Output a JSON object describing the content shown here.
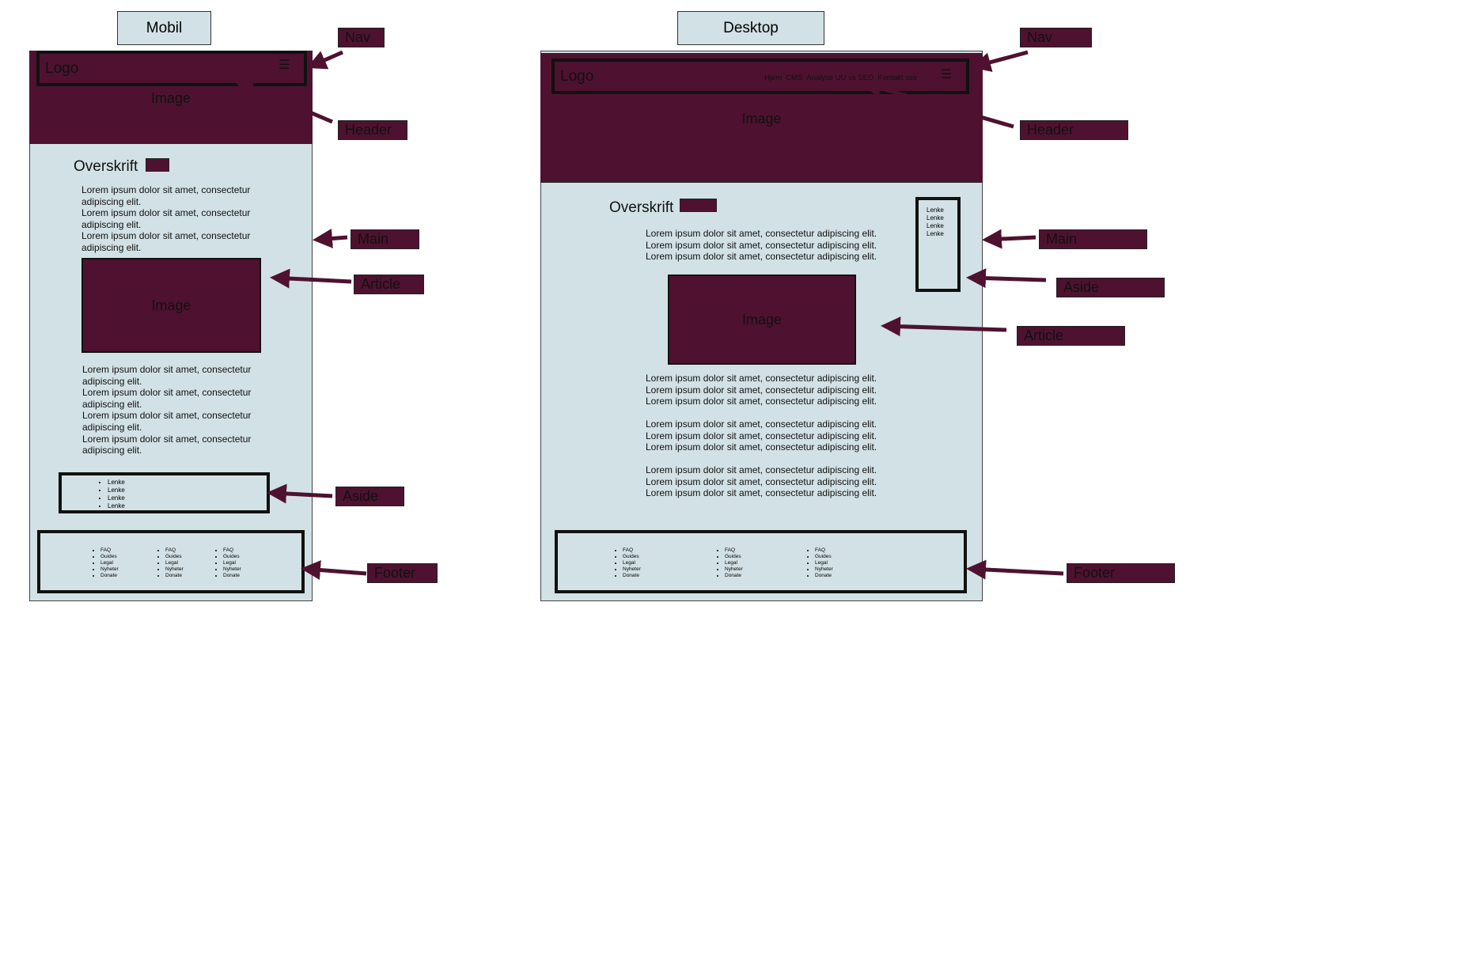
{
  "mobile": {
    "title": "Mobil",
    "logo": "Logo",
    "header_image": "Image",
    "heading": "Overskrift",
    "intro_lines": [
      "Lorem ipsum dolor sit amet, consectetur",
      "adipiscing elit.",
      "Lorem ipsum dolor sit amet, consectetur",
      "adipiscing elit.",
      "Lorem ipsum dolor sit amet, consectetur",
      "adipiscing elit."
    ],
    "article_image": "Image",
    "body_lines": [
      "Lorem ipsum dolor sit amet, consectetur",
      "adipiscing elit.",
      "Lorem ipsum dolor sit amet, consectetur",
      "adipiscing elit.",
      "Lorem ipsum dolor sit amet, consectetur",
      "adipiscing elit.",
      "Lorem ipsum dolor sit amet, consectetur",
      "adipiscing elit."
    ],
    "aside_links": [
      "Lenke",
      "Lenke",
      "Lenke",
      "Lenke"
    ],
    "footer_columns": [
      [
        "FAQ",
        "Guides",
        "Legal",
        "Nyheter",
        "Donate"
      ],
      [
        "FAQ",
        "Guides",
        "Legal",
        "Nyheter",
        "Donate"
      ],
      [
        "FAQ",
        "Guides",
        "Legal",
        "Nyheter",
        "Donate"
      ]
    ],
    "labels": {
      "nav": "Nav",
      "header": "Header",
      "main": "Main",
      "article": "Article",
      "aside": "Aside",
      "footer": "Footer"
    }
  },
  "desktop": {
    "title": "Desktop",
    "logo": "Logo",
    "nav_links": [
      "Hjem",
      "CMS",
      "Analyse UU vs SEO",
      "Kontakt oss"
    ],
    "header_image": "Image",
    "heading": "Overskrift",
    "intro_lines": [
      "Lorem ipsum dolor sit amet, consectetur adipiscing elit.",
      "Lorem ipsum dolor sit amet, consectetur adipiscing elit.",
      "Lorem ipsum dolor sit amet, consectetur adipiscing elit."
    ],
    "article_image": "Image",
    "paragraphs": [
      [
        "Lorem ipsum dolor sit amet, consectetur adipiscing elit.",
        "Lorem ipsum dolor sit amet, consectetur adipiscing elit.",
        "Lorem ipsum dolor sit amet, consectetur adipiscing elit."
      ],
      [
        "Lorem ipsum dolor sit amet, consectetur adipiscing elit.",
        "Lorem ipsum dolor sit amet, consectetur adipiscing elit.",
        "Lorem ipsum dolor sit amet, consectetur adipiscing elit."
      ],
      [
        "Lorem ipsum dolor sit amet, consectetur adipiscing elit.",
        "Lorem ipsum dolor sit amet, consectetur adipiscing elit.",
        "Lorem ipsum dolor sit amet, consectetur adipiscing elit."
      ]
    ],
    "aside_links": [
      "Lenke",
      "Lenke",
      "Lenke",
      "Lenke"
    ],
    "footer_columns": [
      [
        "FAQ",
        "Guides",
        "Legal",
        "Nyheter",
        "Donate"
      ],
      [
        "FAQ",
        "Guides",
        "Legal",
        "Nyheter",
        "Donate"
      ],
      [
        "FAQ",
        "Guides",
        "Legal",
        "Nyheter",
        "Donate"
      ]
    ],
    "labels": {
      "nav": "Nav",
      "header": "Header",
      "main": "Main",
      "aside": "Aside",
      "article": "Article",
      "footer": "Footer"
    }
  },
  "colors": {
    "frame": "#d2e1e5",
    "accent": "#4e1230",
    "outline": "#111111"
  },
  "icons": {
    "menu": "hamburger-icon",
    "arrow": "arrow-icon"
  }
}
